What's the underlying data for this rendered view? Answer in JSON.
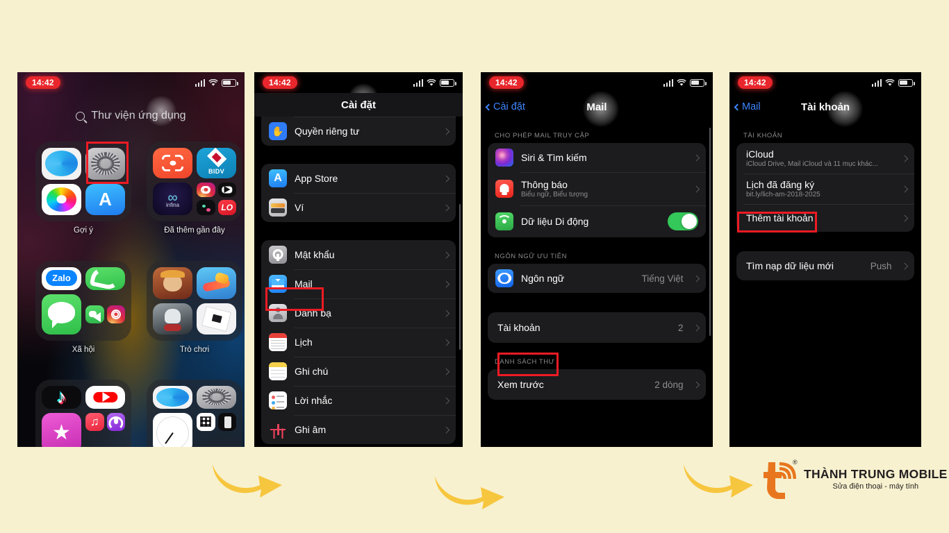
{
  "page": {
    "background_color": "#f7f1cf",
    "accent_highlight_color": "#ee1b24",
    "arrow_color": "#f7c63f"
  },
  "status_bar": {
    "time": "14:42",
    "signal_icon": "cellular-signal-icon",
    "wifi_icon": "wifi-icon",
    "battery_icon": "battery-icon"
  },
  "screen1_home": {
    "search_placeholder": "Thư viện ứng dụng",
    "search_icon": "search-icon",
    "folders": [
      {
        "label": "Gợi ý",
        "apps": [
          "Safari",
          "Cài đặt",
          "Ảnh",
          "App Store"
        ]
      },
      {
        "label": "Đã thêm gần đây",
        "apps": [
          "Quét mã",
          "BIDV",
          "Infina",
          "Instagram",
          "YouTube",
          "Beat",
          "LO"
        ]
      },
      {
        "label": "Xã hội",
        "apps": [
          "Zalo",
          "Điện thoại",
          "Tin nhắn",
          "FaceTime",
          "Instagram"
        ]
      },
      {
        "label": "Trò chơi",
        "apps": [
          "Free Fire",
          "Candy Crush",
          "Zombie",
          "Roblox"
        ]
      },
      {
        "label": "",
        "apps": [
          "TikTok",
          "YouTube",
          "Star",
          "Nhạc",
          "Podcast"
        ]
      },
      {
        "label": "",
        "apps": [
          "Safari",
          "Cài đặt",
          "Đồng hồ",
          "Máy tính",
          "Pin"
        ]
      }
    ],
    "highlight": "Cài đặt"
  },
  "screen2_settings": {
    "title": "Cài đặt",
    "groups": [
      {
        "rows": [
          {
            "label": "Quyền riêng tư",
            "icon": "privacy-icon",
            "chevron": true
          }
        ]
      },
      {
        "rows": [
          {
            "label": "App Store",
            "icon": "appstore-icon",
            "chevron": true
          },
          {
            "label": "Ví",
            "icon": "wallet-icon",
            "chevron": true
          }
        ]
      },
      {
        "rows": [
          {
            "label": "Mật khẩu",
            "icon": "key-icon",
            "chevron": true
          },
          {
            "label": "Mail",
            "icon": "mail-icon",
            "chevron": true,
            "highlighted": true
          },
          {
            "label": "Danh bạ",
            "icon": "contacts-icon",
            "chevron": true
          },
          {
            "label": "Lịch",
            "icon": "calendar-icon",
            "chevron": true
          },
          {
            "label": "Ghi chú",
            "icon": "notes-icon",
            "chevron": true
          },
          {
            "label": "Lời nhắc",
            "icon": "reminders-icon",
            "chevron": true
          },
          {
            "label": "Ghi âm",
            "icon": "voice-memos-icon",
            "chevron": true
          }
        ]
      }
    ]
  },
  "screen3_mail": {
    "back_label": "Cài đặt",
    "title": "Mail",
    "section1_header": "CHO PHÉP MAIL TRUY CẬP",
    "section1_rows": [
      {
        "label": "Siri & Tìm kiếm",
        "icon": "siri-icon",
        "chevron": true
      },
      {
        "label": "Thông báo",
        "sub": "Biểu ngữ, Biểu tượng",
        "icon": "notifications-icon",
        "chevron": true
      },
      {
        "label": "Dữ liệu Di động",
        "icon": "cellular-data-icon",
        "toggle": "on"
      }
    ],
    "section2_header": "NGÔN NGỮ ƯU TIÊN",
    "section2_rows": [
      {
        "label": "Ngôn ngữ",
        "value": "Tiếng Việt",
        "icon": "language-icon",
        "chevron": true
      }
    ],
    "section3_rows": [
      {
        "label": "Tài khoản",
        "value": "2",
        "chevron": true,
        "highlighted": true
      }
    ],
    "section4_header": "DANH SÁCH THƯ",
    "section4_rows": [
      {
        "label": "Xem trước",
        "value": "2 dòng",
        "chevron": true
      }
    ]
  },
  "screen4_accounts": {
    "back_label": "Mail",
    "title": "Tài khoản",
    "section1_header": "TÀI KHOẢN",
    "section1_rows": [
      {
        "label": "iCloud",
        "sub": "iCloud Drive, Mail iCloud và 11 mục khác...",
        "chevron": true
      },
      {
        "label": "Lịch đã đăng ký",
        "sub": "bit.ly/lich-am-2018-2025",
        "chevron": true
      },
      {
        "label": "Thêm tài khoản",
        "chevron": true,
        "highlighted": true
      }
    ],
    "section2_rows": [
      {
        "label": "Tìm nạp dữ liệu mới",
        "value": "Push",
        "chevron": true
      }
    ]
  },
  "arrows": [
    {
      "name": "arrow-step-1-to-2"
    },
    {
      "name": "arrow-step-2-to-3"
    },
    {
      "name": "arrow-step-3-to-4"
    }
  ],
  "brand": {
    "name": "THÀNH TRUNG MOBILE",
    "tagline": "Sửa điện thoại - máy tính",
    "mark_icon": "wifi-t-logo-icon",
    "registered_mark": "®",
    "color": "#e8761e"
  }
}
